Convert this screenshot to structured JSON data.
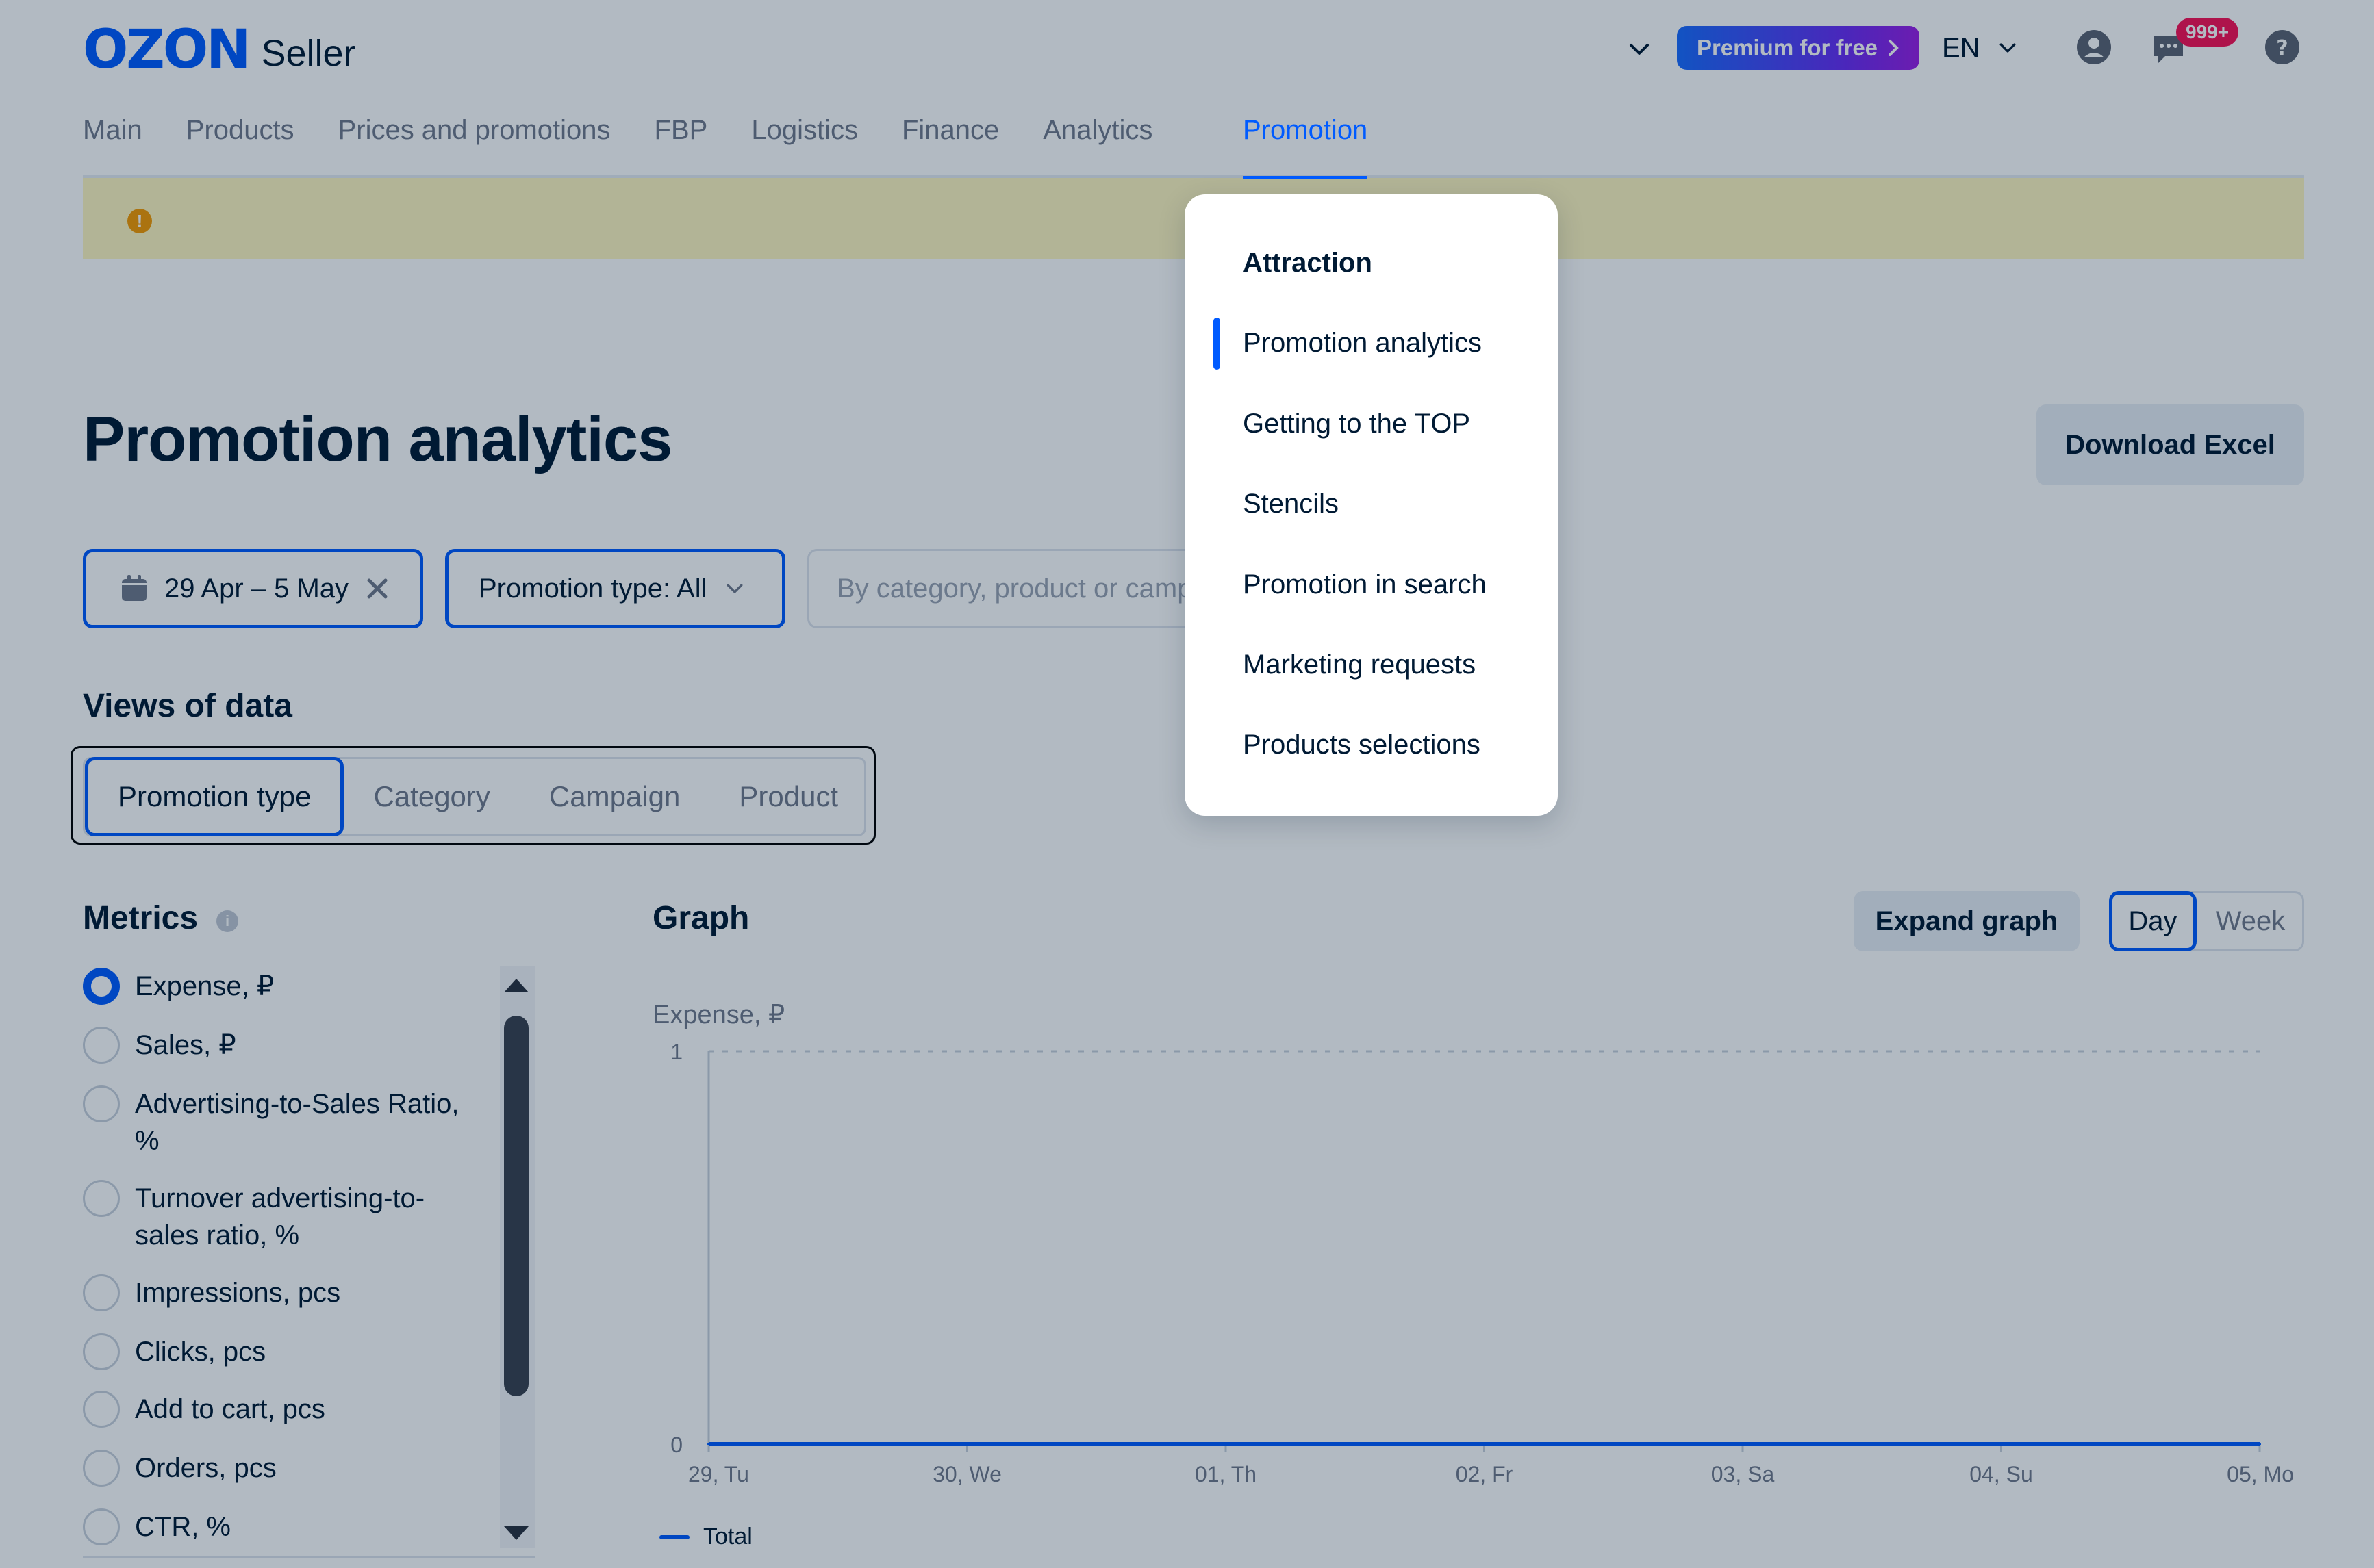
{
  "header": {
    "logo_brand": "OZON",
    "logo_product": "Seller",
    "premium_label": "Premium for free",
    "language": "EN",
    "notifications_count": "999+"
  },
  "nav": {
    "items": [
      {
        "label": "Main"
      },
      {
        "label": "Products"
      },
      {
        "label": "Prices and promotions"
      },
      {
        "label": "FBP"
      },
      {
        "label": "Logistics"
      },
      {
        "label": "Finance"
      },
      {
        "label": "Analytics"
      }
    ],
    "active_label": "Promotion"
  },
  "banner": {
    "icon": "!"
  },
  "page": {
    "title": "Promotion analytics",
    "download_label": "Download Excel"
  },
  "filters": {
    "date_range": "29 Apr – 5 May",
    "promotion_type": "Promotion type: All",
    "search_placeholder": "By category, product or campaign"
  },
  "views": {
    "title": "Views of data",
    "tabs": [
      {
        "label": "Promotion type"
      },
      {
        "label": "Category"
      },
      {
        "label": "Campaign"
      },
      {
        "label": "Product"
      }
    ]
  },
  "metrics": {
    "title": "Metrics",
    "items": [
      {
        "label": "Expense, ₽"
      },
      {
        "label": "Sales, ₽"
      },
      {
        "label": "Advertising-to-Sales Ratio,",
        "label2": "%"
      },
      {
        "label": "Turnover advertising-to-",
        "label2": "sales ratio, %"
      },
      {
        "label": "Impressions, pcs"
      },
      {
        "label": "Clicks, pcs"
      },
      {
        "label": "Add to cart, pcs"
      },
      {
        "label": "Orders, pcs"
      },
      {
        "label": "CTR, %"
      }
    ]
  },
  "graph": {
    "title": "Graph",
    "expand_label": "Expand graph",
    "period_day": "Day",
    "period_week": "Week"
  },
  "chart_data": {
    "type": "line",
    "ylabel": "Expense, ₽",
    "ylim": [
      0,
      1
    ],
    "yticks": [
      "1",
      "0"
    ],
    "categories": [
      "29, Tu",
      "30, We",
      "01, Th",
      "02, Fr",
      "03, Sa",
      "04, Su",
      "05, Mo"
    ],
    "series": [
      {
        "name": "Total",
        "values": [
          0,
          0,
          0,
          0,
          0,
          0,
          0
        ],
        "color": "#005bff"
      }
    ]
  },
  "dropdown": {
    "heading": "Attraction",
    "items": [
      {
        "label": "Promotion analytics"
      },
      {
        "label": "Getting to the TOP"
      },
      {
        "label": "Stencils"
      },
      {
        "label": "Promotion in search"
      },
      {
        "label": "Marketing requests"
      },
      {
        "label": "Products selections"
      }
    ]
  },
  "colors": {
    "accent": "#005bff",
    "badge": "#f91155",
    "banner": "#fff7c0"
  }
}
